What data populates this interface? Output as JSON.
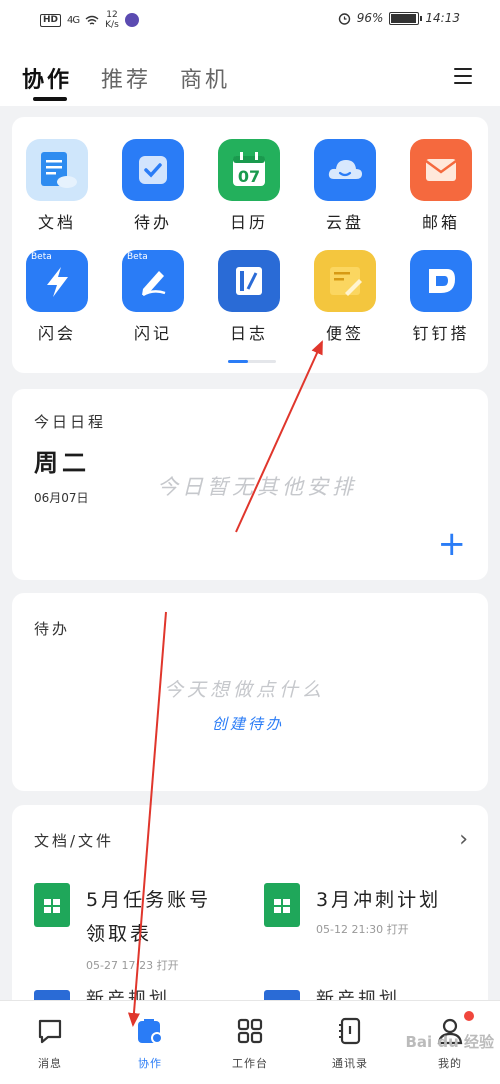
{
  "status_bar": {
    "network": "4G",
    "hd": "HD",
    "speed_value": "12",
    "speed_unit": "K/s",
    "battery": "96%",
    "time": "14:13",
    "battery_level": 0.96
  },
  "header": {
    "tabs": [
      "协作",
      "推荐",
      "商机"
    ],
    "active_tab": "协作"
  },
  "apps": [
    {
      "label": "文档",
      "color": "#2e8cf0",
      "icon": "document-icon"
    },
    {
      "label": "待办",
      "color": "#2a7cf6",
      "icon": "todo-check-icon"
    },
    {
      "label": "日历",
      "color": "#23b05c",
      "icon": "calendar-icon",
      "icon_text": "07"
    },
    {
      "label": "云盘",
      "color": "#2a7cf6",
      "icon": "cloud-icon"
    },
    {
      "label": "邮箱",
      "color": "#f5693e",
      "icon": "mail-icon"
    },
    {
      "label": "闪会",
      "color": "#2a7cf6",
      "icon": "flash-meeting-icon",
      "badge": "Beta"
    },
    {
      "label": "闪记",
      "color": "#2a7cf6",
      "icon": "flash-note-icon",
      "badge": "Beta"
    },
    {
      "label": "日志",
      "color": "#2a6bd6",
      "icon": "log-icon"
    },
    {
      "label": "便签",
      "color": "#f4c63e",
      "icon": "sticky-note-icon"
    },
    {
      "label": "钉钉搭",
      "color": "#2a7cf6",
      "icon": "dingtalk-builder-icon"
    }
  ],
  "schedule": {
    "title": "今日日程",
    "weekday": "周二",
    "date": "06月07日",
    "empty_hint": "今日暂无其他安排"
  },
  "todo": {
    "title": "待办",
    "empty_hint": "今天想做点什么",
    "create_link": "创建待办"
  },
  "docs": {
    "title": "文档/文件",
    "items": [
      {
        "name_line1": "5月任务账号",
        "name_line2": "领取表",
        "meta": "05-27 17:23 打开"
      },
      {
        "name_line1": "3月冲刺计划",
        "name_line2": "",
        "meta": "05-12 21:30 打开"
      }
    ],
    "partial_label_1": "新产规划",
    "partial_label_2": "新产规划"
  },
  "bottom_nav": [
    {
      "label": "消息",
      "icon": "message-icon"
    },
    {
      "label": "协作",
      "icon": "collaboration-icon"
    },
    {
      "label": "工作台",
      "icon": "workbench-icon"
    },
    {
      "label": "通讯录",
      "icon": "contacts-icon"
    },
    {
      "label": "我的",
      "icon": "profile-icon"
    }
  ],
  "watermark": "Bai du 经验",
  "colors": {
    "accent": "#2a7cf6",
    "annotation_arrow": "#e0362c"
  }
}
